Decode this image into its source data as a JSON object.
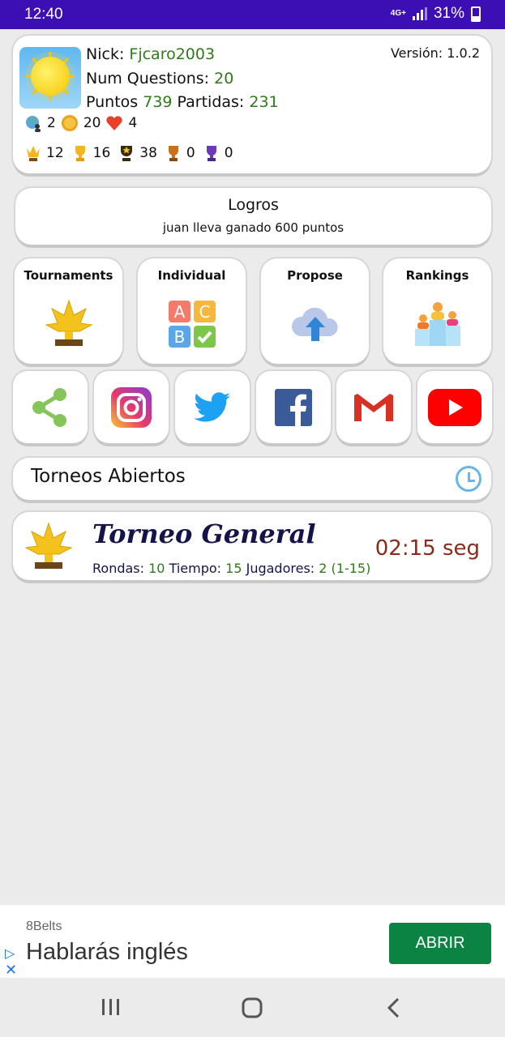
{
  "status": {
    "time": "12:40",
    "network": "4G+",
    "battery": "31%"
  },
  "profile": {
    "nick_label": "Nick:",
    "nick": "Fjcaro2003",
    "questions_label": "Num Questions:",
    "questions": "20",
    "points_label": "Puntos",
    "points": "739",
    "games_label": "Partidas:",
    "games": "231",
    "version": "Versión: 1.0.2",
    "stats": [
      {
        "icon": "globe-user-icon",
        "value": "2"
      },
      {
        "icon": "coin-icon",
        "value": "20"
      },
      {
        "icon": "heart-icon",
        "value": "4"
      }
    ],
    "trophies": [
      {
        "icon": "crown-trophy-icon",
        "value": "12"
      },
      {
        "icon": "gold-trophy-icon",
        "value": "16"
      },
      {
        "icon": "star-trophy-icon",
        "value": "38"
      },
      {
        "icon": "bronze-trophy-icon",
        "value": "0"
      },
      {
        "icon": "purple-trophy-icon",
        "value": "0"
      }
    ]
  },
  "logros": {
    "title": "Logros",
    "subtitle": "juan lleva ganado 600 puntos"
  },
  "tiles": [
    {
      "label": "Tournaments",
      "icon": "tournament-icon"
    },
    {
      "label": "Individual",
      "icon": "abc-quiz-icon"
    },
    {
      "label": "Propose",
      "icon": "cloud-upload-icon"
    },
    {
      "label": "Rankings",
      "icon": "podium-icon"
    }
  ],
  "social": [
    "share-icon",
    "instagram-icon",
    "twitter-icon",
    "facebook-icon",
    "gmail-icon",
    "youtube-icon"
  ],
  "torneos": {
    "title": "Torneos Abiertos"
  },
  "tournament": {
    "name": "Torneo General",
    "time": "02:15 seg",
    "rounds_label": "Rondas:",
    "rounds": "10",
    "time_label": "Tiempo:",
    "time_value": "15",
    "players_label": "Jugadores:",
    "players": "2 (1-15)"
  },
  "ad": {
    "brand": "8Belts",
    "headline": "Hablarás inglés",
    "button": "ABRIR"
  },
  "colors": {
    "status_bar": "#3c0fb4",
    "value_green": "#2f7a1a",
    "title_navy": "#14144a",
    "time_red": "#8b2a1a",
    "ad_button": "#0b8343"
  }
}
